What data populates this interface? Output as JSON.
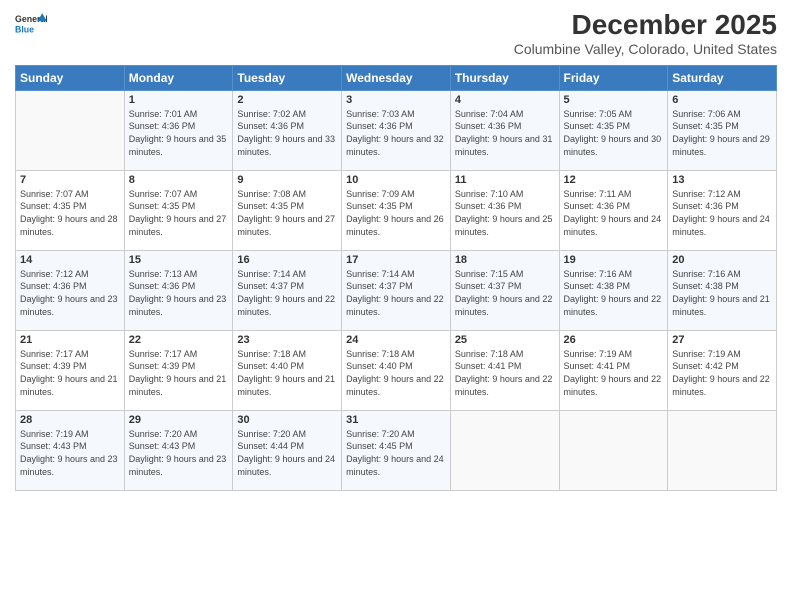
{
  "header": {
    "logo_line1": "General",
    "logo_line2": "Blue",
    "month": "December 2025",
    "location": "Columbine Valley, Colorado, United States"
  },
  "weekdays": [
    "Sunday",
    "Monday",
    "Tuesday",
    "Wednesday",
    "Thursday",
    "Friday",
    "Saturday"
  ],
  "weeks": [
    [
      {
        "day": "",
        "sunrise": "",
        "sunset": "",
        "daylight": ""
      },
      {
        "day": "1",
        "sunrise": "7:01 AM",
        "sunset": "4:36 PM",
        "daylight": "9 hours and 35 minutes."
      },
      {
        "day": "2",
        "sunrise": "7:02 AM",
        "sunset": "4:36 PM",
        "daylight": "9 hours and 33 minutes."
      },
      {
        "day": "3",
        "sunrise": "7:03 AM",
        "sunset": "4:36 PM",
        "daylight": "9 hours and 32 minutes."
      },
      {
        "day": "4",
        "sunrise": "7:04 AM",
        "sunset": "4:36 PM",
        "daylight": "9 hours and 31 minutes."
      },
      {
        "day": "5",
        "sunrise": "7:05 AM",
        "sunset": "4:35 PM",
        "daylight": "9 hours and 30 minutes."
      },
      {
        "day": "6",
        "sunrise": "7:06 AM",
        "sunset": "4:35 PM",
        "daylight": "9 hours and 29 minutes."
      }
    ],
    [
      {
        "day": "7",
        "sunrise": "7:07 AM",
        "sunset": "4:35 PM",
        "daylight": "9 hours and 28 minutes."
      },
      {
        "day": "8",
        "sunrise": "7:07 AM",
        "sunset": "4:35 PM",
        "daylight": "9 hours and 27 minutes."
      },
      {
        "day": "9",
        "sunrise": "7:08 AM",
        "sunset": "4:35 PM",
        "daylight": "9 hours and 27 minutes."
      },
      {
        "day": "10",
        "sunrise": "7:09 AM",
        "sunset": "4:35 PM",
        "daylight": "9 hours and 26 minutes."
      },
      {
        "day": "11",
        "sunrise": "7:10 AM",
        "sunset": "4:36 PM",
        "daylight": "9 hours and 25 minutes."
      },
      {
        "day": "12",
        "sunrise": "7:11 AM",
        "sunset": "4:36 PM",
        "daylight": "9 hours and 24 minutes."
      },
      {
        "day": "13",
        "sunrise": "7:12 AM",
        "sunset": "4:36 PM",
        "daylight": "9 hours and 24 minutes."
      }
    ],
    [
      {
        "day": "14",
        "sunrise": "7:12 AM",
        "sunset": "4:36 PM",
        "daylight": "9 hours and 23 minutes."
      },
      {
        "day": "15",
        "sunrise": "7:13 AM",
        "sunset": "4:36 PM",
        "daylight": "9 hours and 23 minutes."
      },
      {
        "day": "16",
        "sunrise": "7:14 AM",
        "sunset": "4:37 PM",
        "daylight": "9 hours and 22 minutes."
      },
      {
        "day": "17",
        "sunrise": "7:14 AM",
        "sunset": "4:37 PM",
        "daylight": "9 hours and 22 minutes."
      },
      {
        "day": "18",
        "sunrise": "7:15 AM",
        "sunset": "4:37 PM",
        "daylight": "9 hours and 22 minutes."
      },
      {
        "day": "19",
        "sunrise": "7:16 AM",
        "sunset": "4:38 PM",
        "daylight": "9 hours and 22 minutes."
      },
      {
        "day": "20",
        "sunrise": "7:16 AM",
        "sunset": "4:38 PM",
        "daylight": "9 hours and 21 minutes."
      }
    ],
    [
      {
        "day": "21",
        "sunrise": "7:17 AM",
        "sunset": "4:39 PM",
        "daylight": "9 hours and 21 minutes."
      },
      {
        "day": "22",
        "sunrise": "7:17 AM",
        "sunset": "4:39 PM",
        "daylight": "9 hours and 21 minutes."
      },
      {
        "day": "23",
        "sunrise": "7:18 AM",
        "sunset": "4:40 PM",
        "daylight": "9 hours and 21 minutes."
      },
      {
        "day": "24",
        "sunrise": "7:18 AM",
        "sunset": "4:40 PM",
        "daylight": "9 hours and 22 minutes."
      },
      {
        "day": "25",
        "sunrise": "7:18 AM",
        "sunset": "4:41 PM",
        "daylight": "9 hours and 22 minutes."
      },
      {
        "day": "26",
        "sunrise": "7:19 AM",
        "sunset": "4:41 PM",
        "daylight": "9 hours and 22 minutes."
      },
      {
        "day": "27",
        "sunrise": "7:19 AM",
        "sunset": "4:42 PM",
        "daylight": "9 hours and 22 minutes."
      }
    ],
    [
      {
        "day": "28",
        "sunrise": "7:19 AM",
        "sunset": "4:43 PM",
        "daylight": "9 hours and 23 minutes."
      },
      {
        "day": "29",
        "sunrise": "7:20 AM",
        "sunset": "4:43 PM",
        "daylight": "9 hours and 23 minutes."
      },
      {
        "day": "30",
        "sunrise": "7:20 AM",
        "sunset": "4:44 PM",
        "daylight": "9 hours and 24 minutes."
      },
      {
        "day": "31",
        "sunrise": "7:20 AM",
        "sunset": "4:45 PM",
        "daylight": "9 hours and 24 minutes."
      },
      {
        "day": "",
        "sunrise": "",
        "sunset": "",
        "daylight": ""
      },
      {
        "day": "",
        "sunrise": "",
        "sunset": "",
        "daylight": ""
      },
      {
        "day": "",
        "sunrise": "",
        "sunset": "",
        "daylight": ""
      }
    ]
  ]
}
